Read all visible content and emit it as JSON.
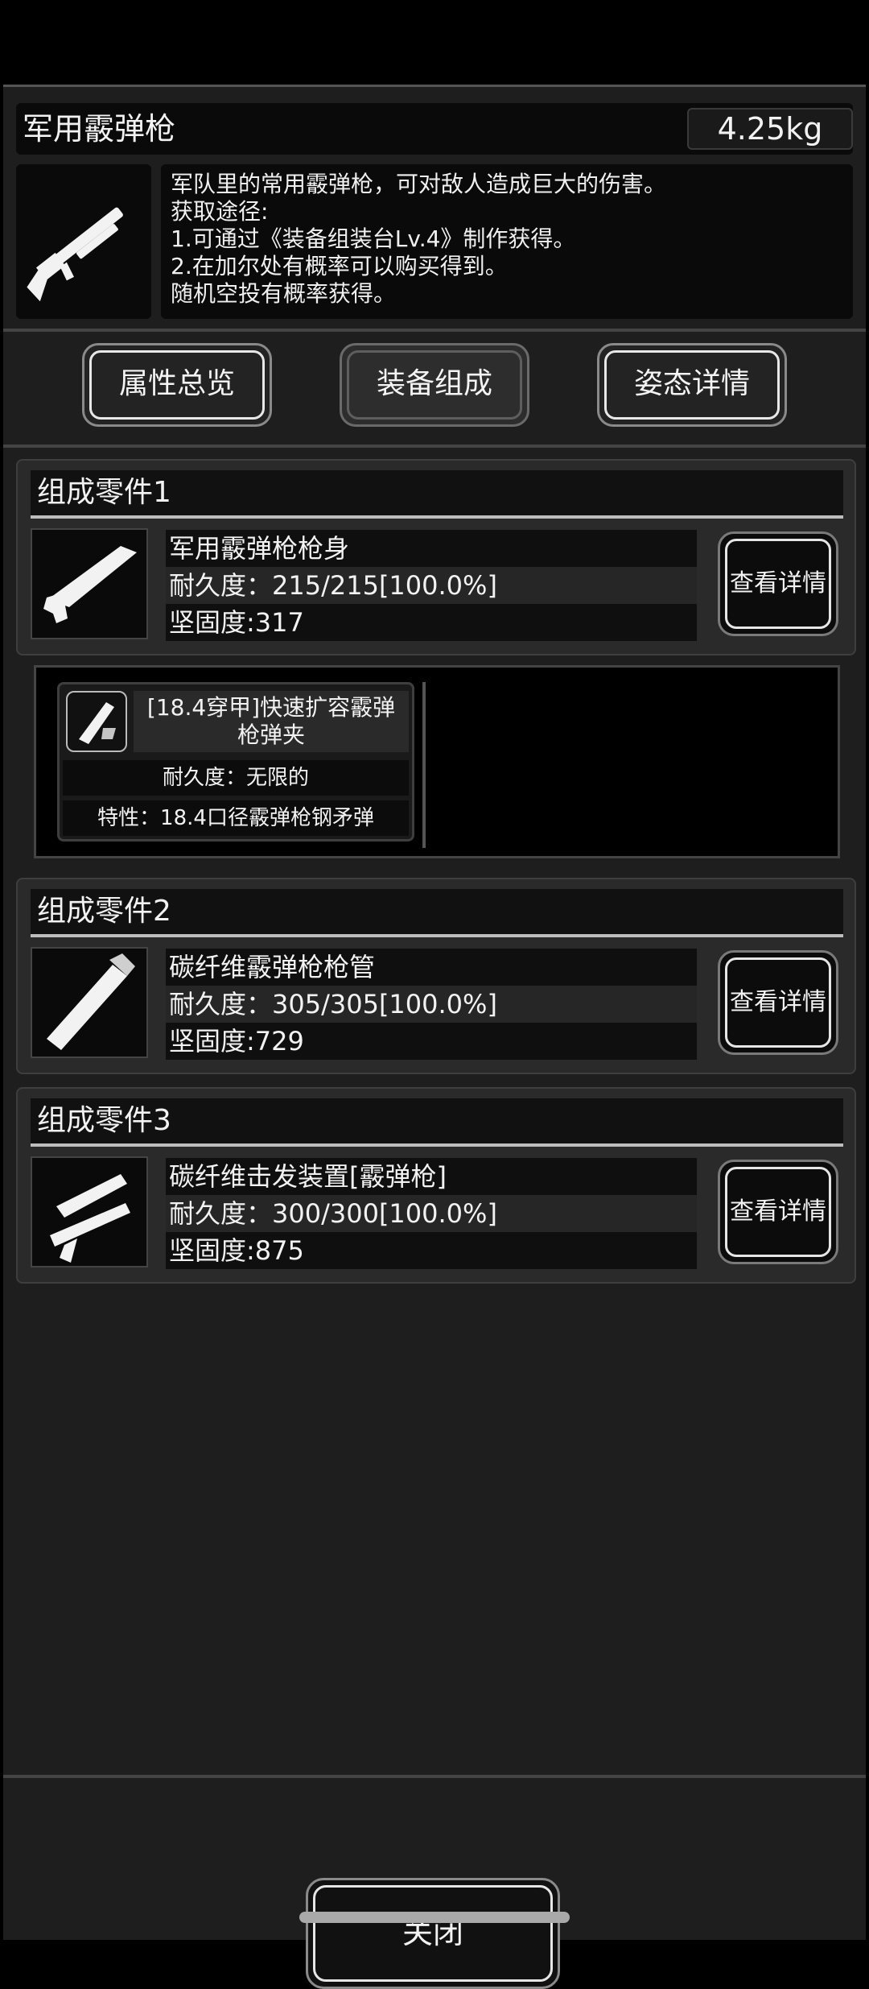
{
  "item": {
    "title": "军用霰弹枪",
    "weight": "4.25kg",
    "icon": "shotgun-icon",
    "description": [
      "军队里的常用霰弹枪，可对敌人造成巨大的伤害。",
      "获取途径:",
      "1.可通过《装备组装台Lv.4》制作获得。",
      "2.在加尔处有概率可以购买得到。",
      "随机空投有概率获得。"
    ]
  },
  "tabs": [
    {
      "label": "属性总览",
      "active": false
    },
    {
      "label": "装备组成",
      "active": true
    },
    {
      "label": "姿态详情",
      "active": false
    }
  ],
  "parts": [
    {
      "header": "组成零件1",
      "name": "军用霰弹枪枪身",
      "durability": "耐久度：215/215[100.0%]",
      "hardness": "坚固度:317",
      "icon": "shotgun-body-icon",
      "detail_label": "查看详情"
    },
    {
      "header": "组成零件2",
      "name": "碳纤维霰弹枪枪管",
      "durability": "耐久度：305/305[100.0%]",
      "hardness": "坚固度:729",
      "icon": "barrel-icon",
      "detail_label": "查看详情"
    },
    {
      "header": "组成零件3",
      "name": "碳纤维击发装置[霰弹枪]",
      "durability": "耐久度：300/300[100.0%]",
      "hardness": "坚固度:875",
      "icon": "trigger-mechanism-icon",
      "detail_label": "查看详情"
    }
  ],
  "magazine": {
    "name_line1": "[18.4穿甲]快速扩容霰弹",
    "name_line2": "枪弹夹",
    "durability": "耐久度：无限的",
    "trait": "特性：18.4口径霰弹枪钢矛弹",
    "icon": "magazine-icon"
  },
  "footer": {
    "close_label": "关闭"
  }
}
